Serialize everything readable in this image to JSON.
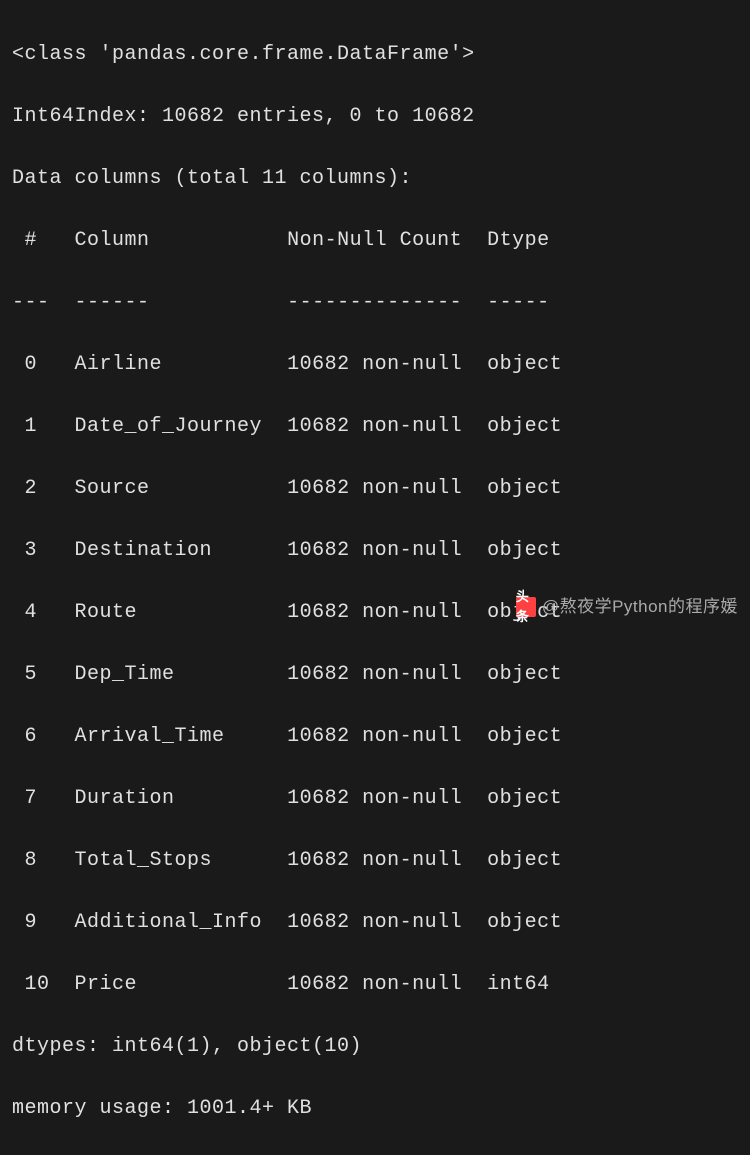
{
  "header": {
    "class_line": "<class 'pandas.core.frame.DataFrame'>",
    "index_line": "Int64Index: 10682 entries, 0 to 10682",
    "columns_line": "Data columns (total 11 columns):"
  },
  "table_header": {
    "num": " # ",
    "column": "Column         ",
    "nonnull": "Non-Null Count",
    "dtype": "Dtype "
  },
  "divider": {
    "num": "---",
    "column": "------         ",
    "nonnull": "--------------",
    "dtype": "----- "
  },
  "rows": [
    {
      "num": " 0 ",
      "column": "Airline        ",
      "nonnull": "10682 non-null",
      "dtype": "object"
    },
    {
      "num": " 1 ",
      "column": "Date_of_Journey",
      "nonnull": "10682 non-null",
      "dtype": "object"
    },
    {
      "num": " 2 ",
      "column": "Source         ",
      "nonnull": "10682 non-null",
      "dtype": "object"
    },
    {
      "num": " 3 ",
      "column": "Destination    ",
      "nonnull": "10682 non-null",
      "dtype": "object"
    },
    {
      "num": " 4 ",
      "column": "Route          ",
      "nonnull": "10682 non-null",
      "dtype": "object"
    },
    {
      "num": " 5 ",
      "column": "Dep_Time       ",
      "nonnull": "10682 non-null",
      "dtype": "object"
    },
    {
      "num": " 6 ",
      "column": "Arrival_Time   ",
      "nonnull": "10682 non-null",
      "dtype": "object"
    },
    {
      "num": " 7 ",
      "column": "Duration       ",
      "nonnull": "10682 non-null",
      "dtype": "object"
    },
    {
      "num": " 8 ",
      "column": "Total_Stops    ",
      "nonnull": "10682 non-null",
      "dtype": "object"
    },
    {
      "num": " 9 ",
      "column": "Additional_Info",
      "nonnull": "10682 non-null",
      "dtype": "object"
    },
    {
      "num": " 10",
      "column": "Price          ",
      "nonnull": "10682 non-null",
      "dtype": "int64 "
    }
  ],
  "footer": {
    "dtypes_line": "dtypes: int64(1), object(10)",
    "memory_line": "memory usage: 1001.4+ KB"
  },
  "watermark": {
    "logo": "头条",
    "text": "@熬夜学Python的程序媛"
  }
}
